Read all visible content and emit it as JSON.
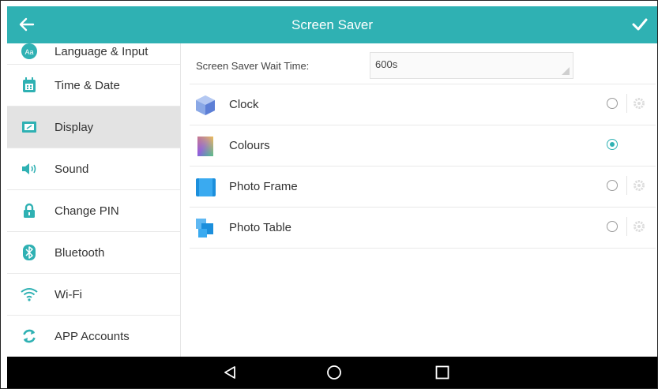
{
  "header": {
    "title": "Screen Saver",
    "back_icon": "back-arrow-icon",
    "confirm_icon": "check-icon",
    "color": "#2fb1b3"
  },
  "sidebar": {
    "items": [
      {
        "label": "Language & Input",
        "icon": "language-icon"
      },
      {
        "label": "Time & Date",
        "icon": "calendar-icon"
      },
      {
        "label": "Display",
        "icon": "display-icon",
        "active": true
      },
      {
        "label": "Sound",
        "icon": "speaker-icon"
      },
      {
        "label": "Change PIN",
        "icon": "lock-icon"
      },
      {
        "label": "Bluetooth",
        "icon": "bluetooth-icon"
      },
      {
        "label": "Wi-Fi",
        "icon": "wifi-icon"
      },
      {
        "label": "APP Accounts",
        "icon": "sync-icon"
      }
    ]
  },
  "main": {
    "wait_time": {
      "label": "Screen Saver Wait Time:",
      "value": "600s"
    },
    "options": [
      {
        "label": "Clock",
        "icon": "clock-cube-icon",
        "selected": false
      },
      {
        "label": "Colours",
        "icon": "colours-icon",
        "selected": true
      },
      {
        "label": "Photo Frame",
        "icon": "photo-frame-icon",
        "selected": false
      },
      {
        "label": "Photo Table",
        "icon": "photo-table-icon",
        "selected": false
      }
    ]
  },
  "navbar": {
    "buttons": [
      "back-triangle-icon",
      "home-circle-icon",
      "recents-square-icon"
    ]
  }
}
